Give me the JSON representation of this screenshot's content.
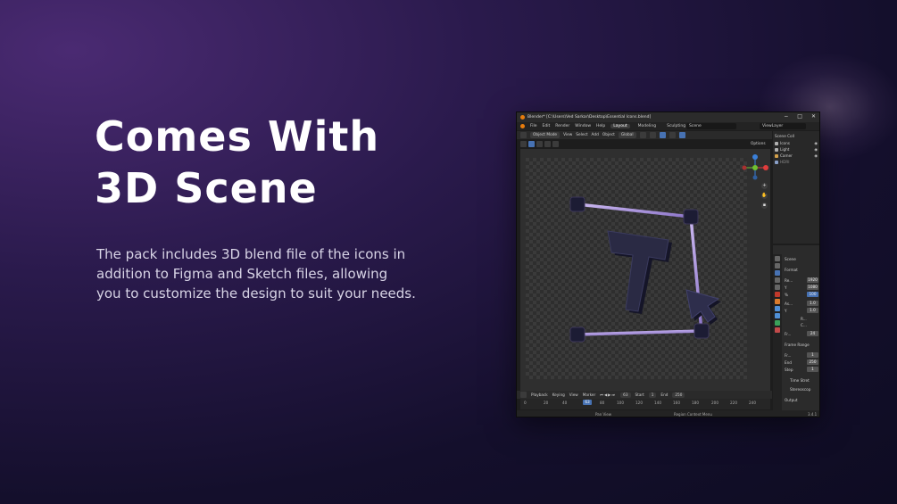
{
  "headline": {
    "line1": "Comes With",
    "line2": "3D Scene"
  },
  "description": {
    "line1": "The pack includes 3D blend file of the icons in",
    "line2": "addition to Figma and Sketch files, allowing",
    "line3": "you to customize the design to suit your needs."
  },
  "blender": {
    "title": "Blender* [C:\\Users\\Ved Sarkar\\Desktop\\Essential Icons.blend]",
    "window_controls": {
      "minimize": "−",
      "maximize": "□",
      "close": "✕"
    },
    "menu": [
      "File",
      "Edit",
      "Render",
      "Window",
      "Help"
    ],
    "workspaces": [
      "Layout",
      "Modeling",
      "Sculpting",
      "UV Ed"
    ],
    "scene_field": "Scene",
    "view_layer_field": "ViewLayer",
    "header": {
      "mode": "Object Mode",
      "items": [
        "View",
        "Select",
        "Add",
        "Object"
      ],
      "transform": "Global"
    },
    "options_label": "Options",
    "outliner": {
      "title": "Scene Coll",
      "items": [
        {
          "name": "Icons",
          "color": "#b0b0b0"
        },
        {
          "name": "Light",
          "color": "#b0b0b0"
        },
        {
          "name": "Camer",
          "color": "#d3a04a"
        },
        {
          "name": "HDRI",
          "color": "#8aa0c8"
        }
      ]
    },
    "properties": {
      "scene_label": "Scene",
      "format_label": "Format",
      "fields": [
        {
          "label": "Re...",
          "value": "1920"
        },
        {
          "label": "Y",
          "value": "1080"
        },
        {
          "label": "%",
          "value": "100",
          "highlight": true
        },
        {
          "label": "As...",
          "value": "1.0"
        },
        {
          "label": "Y",
          "value": "1.0"
        },
        {
          "label": "R...",
          "value": ""
        },
        {
          "label": "C...",
          "value": ""
        },
        {
          "label": "Fr...",
          "value": "24"
        }
      ],
      "frame_range_label": "Frame Range",
      "frame_fields": [
        {
          "label": "Fr...",
          "value": "1"
        },
        {
          "label": "End",
          "value": "250"
        },
        {
          "label": "Step",
          "value": "1"
        }
      ],
      "time_stretch_label": "Time Stret",
      "stereoscopy_label": "Stereoscop",
      "output_label": "Output"
    },
    "timeline": {
      "items": [
        "Playback",
        "Keying",
        "View",
        "Marker"
      ],
      "current_frame": "63",
      "start_label": "Start",
      "start_value": "1",
      "end_label": "End",
      "end_value": "250",
      "ticks": [
        "0",
        "20",
        "40",
        "63",
        "80",
        "100",
        "120",
        "140",
        "160",
        "180",
        "200",
        "220",
        "240"
      ]
    },
    "status": {
      "pan_view": "Pan View",
      "context_menu": "Region Context Menu",
      "version": "3.4.1"
    },
    "colors": {
      "accent_blue": "#4772b3",
      "frame_edge": "#b39ce0",
      "letter": "#2a2a44",
      "axis_x": "#e03c3c",
      "axis_y": "#70c030",
      "axis_z": "#3a7fd8"
    },
    "icons": [
      "blender-logo-icon",
      "search-icon",
      "hand-pan-icon",
      "zoom-icon",
      "camera-icon",
      "eye-icon",
      "play-icon",
      "cursor-arrow-icon"
    ]
  }
}
